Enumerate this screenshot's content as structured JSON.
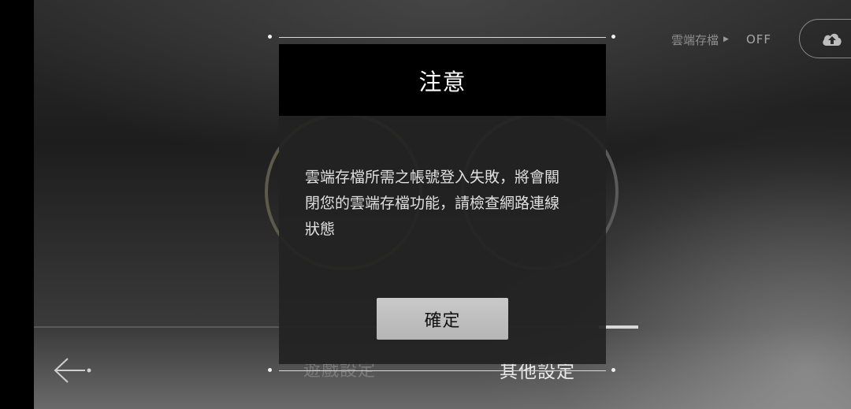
{
  "header": {
    "cloud_save_label": "雲端存檔",
    "cloud_save_state": "OFF"
  },
  "tabs": [
    {
      "label": "遊戲設定",
      "active": false
    },
    {
      "label": "其他設定",
      "active": true
    }
  ],
  "dialog": {
    "title": "注意",
    "message": "雲端存檔所需之帳號登入失敗，將會關\n閉您的雲端存檔功能，請檢查網路連線\n狀態",
    "confirm_label": "確定"
  },
  "icons": {
    "back": "arrow-left-icon",
    "cloud": "cloud-upload-icon",
    "status_arrow": "triangle-right-icon"
  },
  "colors": {
    "dialog_header": "#000000",
    "dialog_body": "#222222",
    "confirm_button": "#c0c0c0",
    "active_tab": "#e8e8e8",
    "inactive_tab": "#7a7a7a"
  }
}
